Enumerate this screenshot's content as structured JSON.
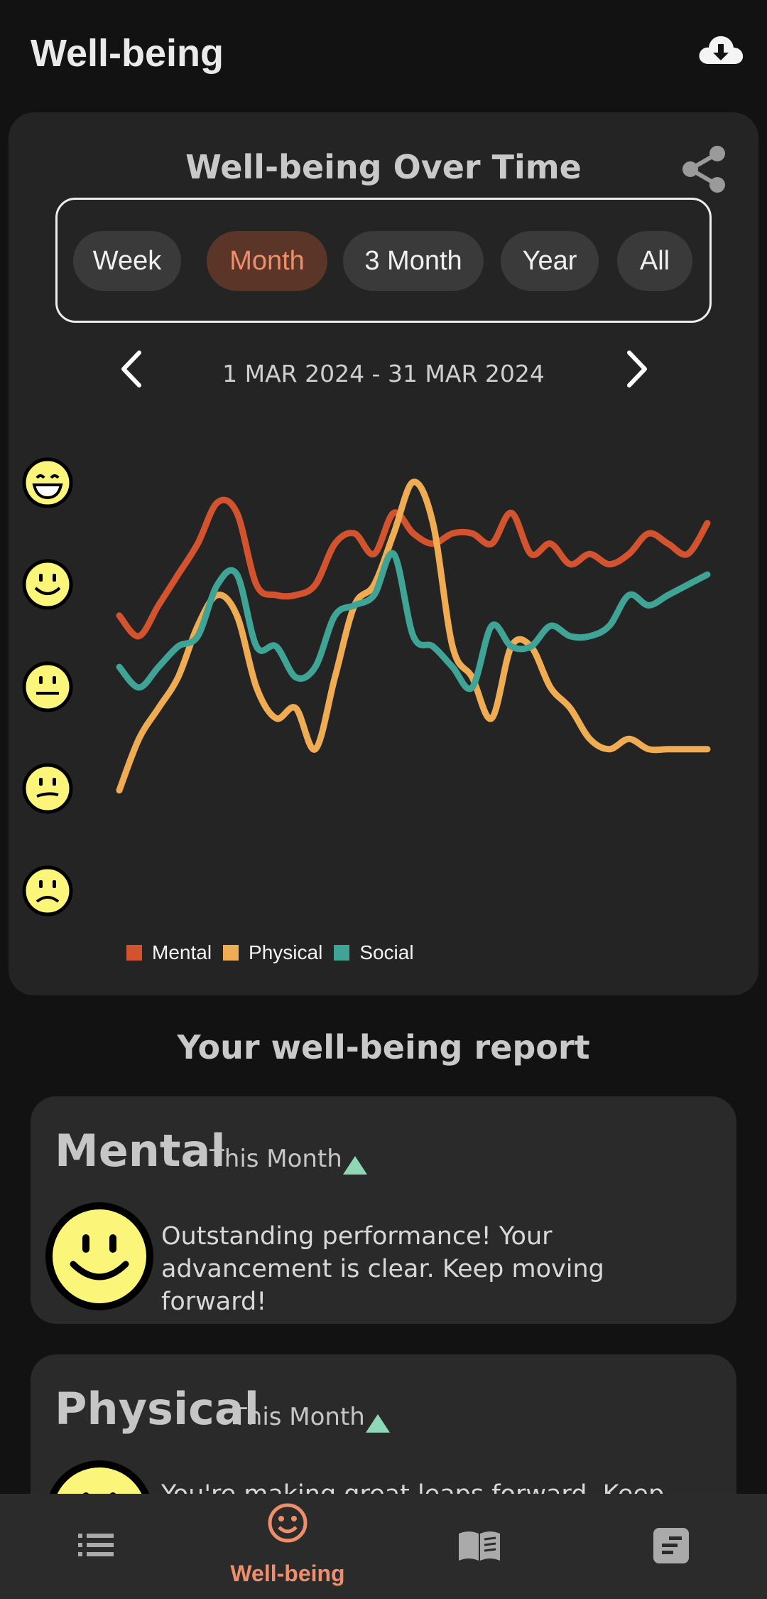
{
  "app_bar": {
    "title": "Well-being",
    "download_icon": "cloud-download-icon"
  },
  "chart_card": {
    "title": "Well-being Over Time",
    "share_icon": "share-icon",
    "ranges": [
      "Week",
      "Month",
      "3 Month",
      "Year",
      "All"
    ],
    "selected_range": "Month",
    "date_range": "1 MAR 2024 - 31 MAR 2024",
    "prev_icon": "chevron-left-icon",
    "next_icon": "chevron-right-icon",
    "mood_scale_icons": [
      "grinning-face-icon",
      "smiling-face-icon",
      "neutral-face-icon",
      "slightly-unhappy-face-icon",
      "frowning-face-icon"
    ]
  },
  "chart_data": {
    "type": "line",
    "x": [
      1,
      2,
      3,
      4,
      5,
      6,
      7,
      8,
      9,
      10,
      11,
      12,
      13,
      14,
      15,
      16,
      17,
      18,
      19,
      20,
      21,
      22,
      23,
      24,
      25,
      26,
      27,
      28,
      29,
      30,
      31
    ],
    "ylim": [
      1,
      5
    ],
    "y_ticks": [
      "frowning",
      "slightly unhappy",
      "neutral",
      "smiling",
      "grinning"
    ],
    "series": [
      {
        "name": "Mental",
        "color": "#d4532f",
        "values": [
          3.7,
          3.5,
          3.8,
          4.1,
          4.4,
          4.8,
          4.7,
          4.0,
          3.9,
          3.9,
          4.0,
          4.4,
          4.5,
          4.3,
          4.7,
          4.5,
          4.4,
          4.5,
          4.5,
          4.4,
          4.7,
          4.3,
          4.4,
          4.2,
          4.3,
          4.2,
          4.3,
          4.5,
          4.4,
          4.3,
          4.6
        ]
      },
      {
        "name": "Physical",
        "color": "#f0ac52",
        "values": [
          2.0,
          2.5,
          2.8,
          3.1,
          3.6,
          3.9,
          3.7,
          3.0,
          2.7,
          2.8,
          2.4,
          3.1,
          3.8,
          4.0,
          4.5,
          5.0,
          4.6,
          3.4,
          3.1,
          2.7,
          3.4,
          3.4,
          3.0,
          2.8,
          2.5,
          2.4,
          2.5,
          2.4,
          2.4,
          2.4,
          2.4
        ]
      },
      {
        "name": "Social",
        "color": "#3fa396",
        "values": [
          3.2,
          3.0,
          3.2,
          3.4,
          3.5,
          4.0,
          4.1,
          3.4,
          3.4,
          3.1,
          3.2,
          3.7,
          3.8,
          3.9,
          4.3,
          3.5,
          3.4,
          3.2,
          3.0,
          3.6,
          3.4,
          3.4,
          3.6,
          3.5,
          3.5,
          3.6,
          3.9,
          3.8,
          3.9,
          4.0,
          4.1
        ]
      }
    ],
    "legend": "bottom-left",
    "grid": false
  },
  "report": {
    "heading": "Your well-being report",
    "cards": [
      {
        "category": "Mental",
        "period": "This Month",
        "trend_icon": "trend-up-icon",
        "face_icon": "smiling-face-icon",
        "message": "Outstanding performance! Your advancement is clear. Keep moving forward!"
      },
      {
        "category": "Physical",
        "period": "This Month",
        "trend_icon": "trend-up-icon",
        "face_icon": "smiling-face-icon",
        "message": "You're making great leaps forward. Keep"
      }
    ]
  },
  "bottom_nav": {
    "items": [
      {
        "icon": "list-icon",
        "label": ""
      },
      {
        "icon": "smiley-icon",
        "label": "Well-being",
        "active": true
      },
      {
        "icon": "book-icon",
        "label": ""
      },
      {
        "icon": "notes-icon",
        "label": ""
      }
    ]
  },
  "colors": {
    "accent": "#ef8e6a",
    "trend_up": "#8fd8b5",
    "face_yellow": "#fbf57a"
  }
}
